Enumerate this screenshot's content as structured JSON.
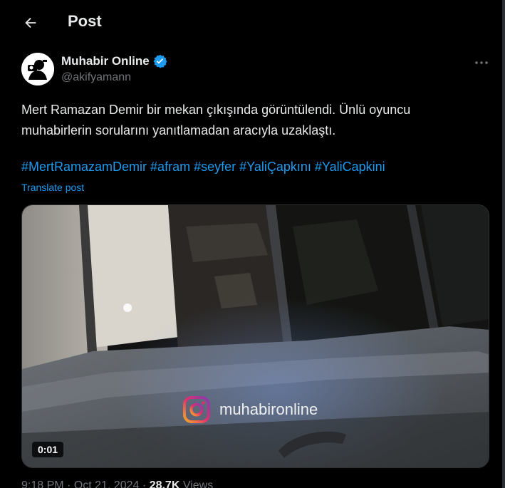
{
  "header": {
    "title": "Post",
    "back_icon": "arrow-left-icon"
  },
  "author": {
    "name": "Muhabir Online",
    "handle": "@akifyamann",
    "verified": true,
    "verified_color": "#1d9bf0"
  },
  "post": {
    "text": "Mert Ramazan Demir bir mekan çıkışında görüntülendi. Ünlü oyuncu muhabirlerin sorularını yanıtlamadan aracıyla uzaklaştı.",
    "hashtags": [
      "#MertRamazamDemir",
      "#afram",
      "#seyfer",
      "#YaliÇapkını",
      "#YaliCapkini"
    ],
    "translate_label": "Translate post"
  },
  "media": {
    "duration": "0:01",
    "watermark": "muhabironline",
    "watermark_icon": "instagram-icon"
  },
  "meta": {
    "time": "9:18 PM",
    "date": "Oct 21, 2024",
    "views_count": "28.7K",
    "views_label": "Views"
  },
  "colors": {
    "background": "#000000",
    "text": "#e7e9ea",
    "secondary": "#71767b",
    "link": "#1d9bf0"
  }
}
